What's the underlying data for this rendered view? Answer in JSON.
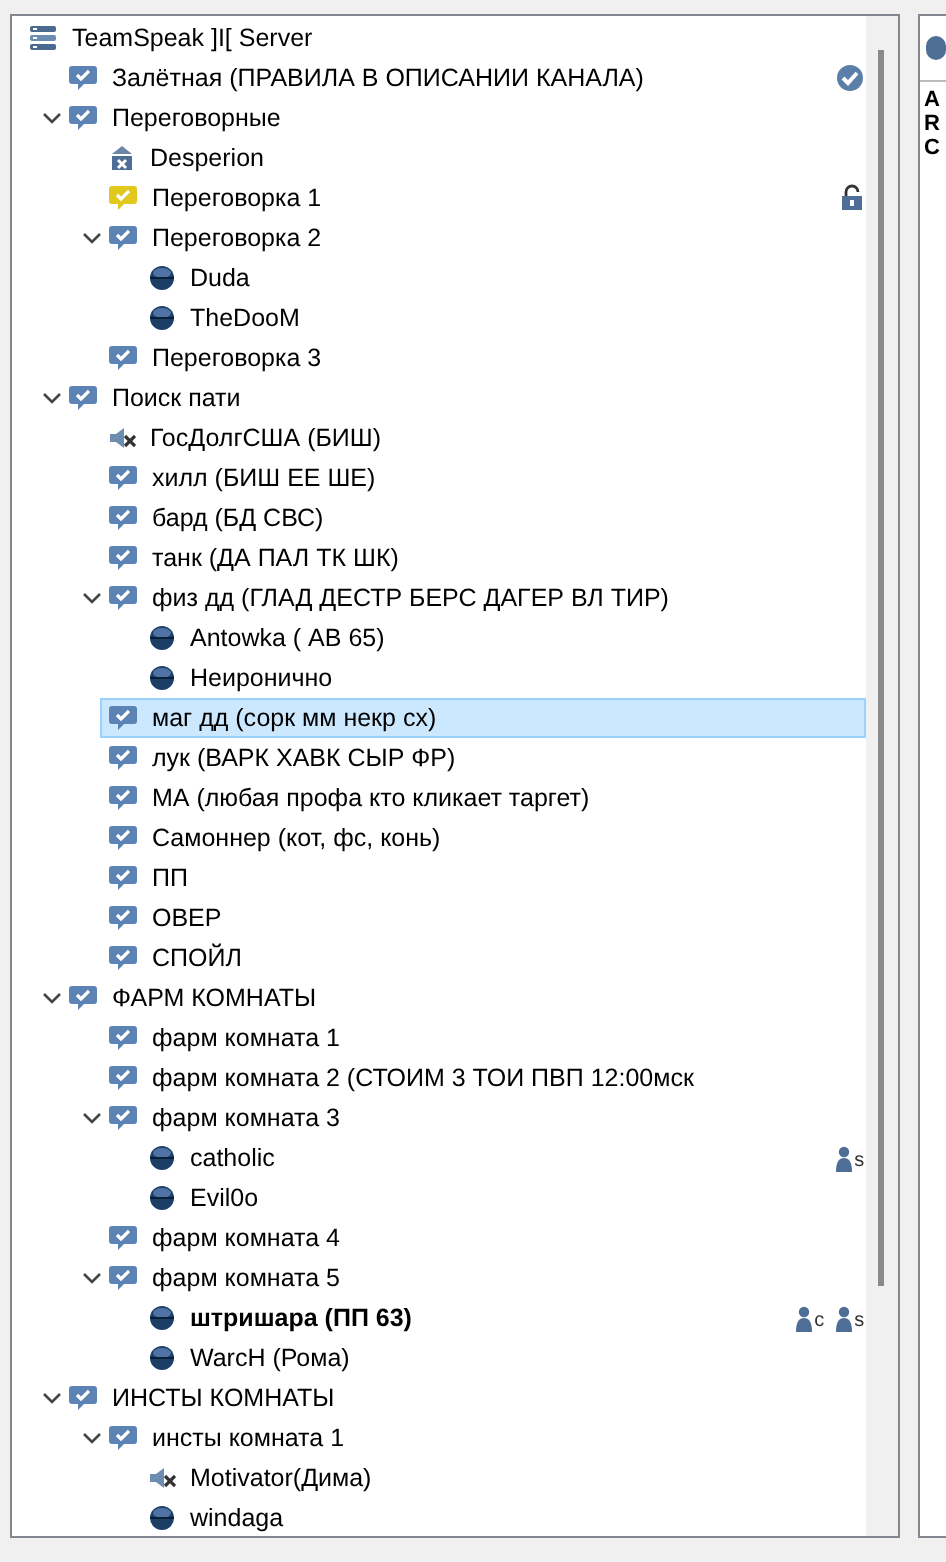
{
  "tree": {
    "server": {
      "label": "TeamSpeak ]I[ Server"
    },
    "items": [
      {
        "kind": "channel",
        "label": "Залётная (ПРАВИЛА В ОПИСАНИИ КАНАЛА)",
        "selected": false,
        "default": true,
        "locked": false
      },
      {
        "kind": "channel",
        "label": "Переговорные",
        "selected": false,
        "expanded": true,
        "children": [
          {
            "kind": "client-away",
            "label": "Desperion",
            "selected": false,
            "self": false
          },
          {
            "kind": "channel-yellow",
            "label": "Переговорка 1",
            "selected": false,
            "locked": true
          },
          {
            "kind": "channel",
            "label": "Переговорка 2",
            "selected": false,
            "expanded": true,
            "children": [
              {
                "kind": "client",
                "label": "Duda",
                "selected": false,
                "self": false
              },
              {
                "kind": "client",
                "label": "TheDooM",
                "selected": false,
                "self": false
              }
            ]
          },
          {
            "kind": "channel",
            "label": "Переговорка 3",
            "selected": false
          }
        ]
      },
      {
        "kind": "channel",
        "label": "Поиск пати",
        "selected": false,
        "expanded": true,
        "children": [
          {
            "kind": "client-muted",
            "label": "ГосДолгСША (БИШ)",
            "selected": false,
            "self": false
          },
          {
            "kind": "channel",
            "label": "хилл (БИШ ЕЕ ШЕ)",
            "selected": false
          },
          {
            "kind": "channel",
            "label": "бард (БД СВС)",
            "selected": false
          },
          {
            "kind": "channel",
            "label": "танк (ДА ПАЛ ТК ШК)",
            "selected": false
          },
          {
            "kind": "channel",
            "label": "физ дд (ГЛАД ДЕСТР БЕРС ДАГЕР ВЛ ТИР)",
            "selected": false,
            "expanded": true,
            "children": [
              {
                "kind": "client",
                "label": "Antowka ( АВ 65)",
                "selected": false,
                "self": false
              },
              {
                "kind": "client",
                "label": "Неиронично",
                "selected": false,
                "self": false
              }
            ]
          },
          {
            "kind": "channel",
            "label": "маг дд (сорк мм некр сх)",
            "selected": true
          },
          {
            "kind": "channel",
            "label": "лук (ВАРК ХАВК СЫР ФР)",
            "selected": false
          },
          {
            "kind": "channel",
            "label": "МА (любая профа кто кликает таргет)",
            "selected": false
          },
          {
            "kind": "channel",
            "label": "Самоннер (кот, фс, конь)",
            "selected": false
          },
          {
            "kind": "channel",
            "label": "ПП",
            "selected": false
          },
          {
            "kind": "channel",
            "label": "ОВЕР",
            "selected": false
          },
          {
            "kind": "channel",
            "label": "СПОЙЛ",
            "selected": false
          }
        ]
      },
      {
        "kind": "channel",
        "label": "ФАРМ КОМНАТЫ",
        "selected": false,
        "expanded": true,
        "children": [
          {
            "kind": "channel",
            "label": "фарм комната 1",
            "selected": false
          },
          {
            "kind": "channel",
            "label": "фарм комната 2 (СТОИМ 3 ТОИ ПВП 12:00мск",
            "selected": false
          },
          {
            "kind": "channel",
            "label": "фарм комната 3",
            "selected": false,
            "expanded": true,
            "children": [
              {
                "kind": "client",
                "label": "catholic",
                "selected": false,
                "self": false,
                "badges": [
                  "s"
                ]
              },
              {
                "kind": "client",
                "label": "Evil0o",
                "selected": false,
                "self": false
              }
            ]
          },
          {
            "kind": "channel",
            "label": "фарм комната 4",
            "selected": false
          },
          {
            "kind": "channel",
            "label": "фарм комната 5",
            "selected": false,
            "expanded": true,
            "children": [
              {
                "kind": "client",
                "label": "штришара (ПП 63)",
                "selected": false,
                "self": true,
                "badges": [
                  "c",
                  "s"
                ]
              },
              {
                "kind": "client",
                "label": "WarcH (Рома)",
                "selected": false,
                "self": false
              }
            ]
          }
        ]
      },
      {
        "kind": "channel",
        "label": "ИНСТЫ КОМНАТЫ",
        "selected": false,
        "expanded": true,
        "children": [
          {
            "kind": "channel",
            "label": "инсты комната 1",
            "selected": false,
            "expanded": true,
            "children": [
              {
                "kind": "client-muted",
                "label": "Motivator(Дима)",
                "selected": false,
                "self": false
              },
              {
                "kind": "client",
                "label": "windaga",
                "selected": false,
                "self": false
              }
            ]
          }
        ]
      }
    ]
  },
  "side_panel": {
    "lines": [
      "A",
      "R",
      "C"
    ]
  }
}
